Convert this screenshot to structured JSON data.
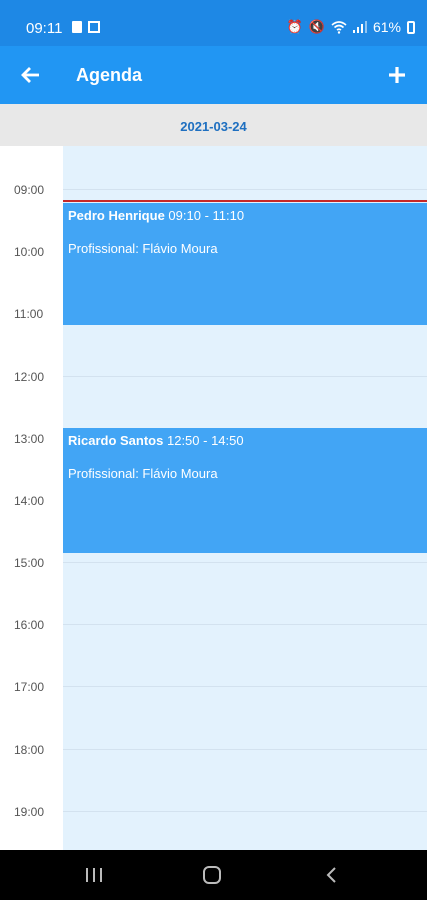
{
  "status_bar": {
    "time": "09:11",
    "battery": "61%",
    "icons": [
      "sim-card-icon",
      "image-icon",
      "alarm-icon",
      "mute-icon",
      "wifi-icon",
      "signal-icon",
      "battery-icon"
    ]
  },
  "app_bar": {
    "title": "Agenda",
    "back_icon": "arrow-left-icon",
    "add_icon": "plus-icon"
  },
  "date": "2021-03-24",
  "hours": [
    "09:00",
    "10:00",
    "11:00",
    "12:00",
    "13:00",
    "14:00",
    "15:00",
    "16:00",
    "17:00",
    "18:00",
    "19:00"
  ],
  "events": [
    {
      "name": "Pedro Henrique",
      "time": "09:10 - 11:10",
      "professional": "Profissional: Flávio Moura"
    },
    {
      "name": "Ricardo Santos",
      "time": "12:50 - 14:50",
      "professional": "Profissional: Flávio Moura"
    }
  ],
  "colors": {
    "app_bar": "#2196f3",
    "status_bar": "#1e88e5",
    "event": "#42a5f5",
    "day_background": "#e3f2fd",
    "current_time_line": "#c62828"
  }
}
